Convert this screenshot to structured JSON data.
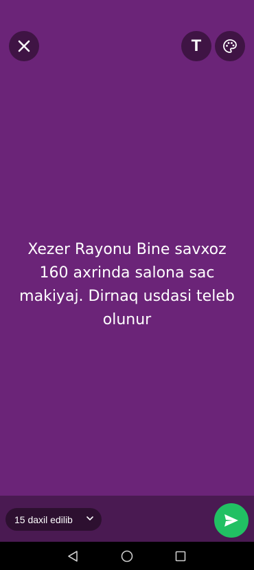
{
  "status": {
    "text": "Xezer Rayonu Bine savxoz 160 axrinda salona sac makiyaj. Dirnaq usdasi teleb olunur",
    "background_color": "#6b2478"
  },
  "toolbar": {
    "close_icon": "close-icon",
    "text_tool_label": "T",
    "palette_icon": "palette-icon"
  },
  "bottom_bar": {
    "audience_label": "15 daxil edilib",
    "audience_icon": "chevron-down-icon",
    "send_icon": "send-icon",
    "send_color": "#21c063"
  },
  "nav": {
    "back_icon": "back-icon",
    "home_icon": "home-icon",
    "recents_icon": "recents-icon"
  }
}
